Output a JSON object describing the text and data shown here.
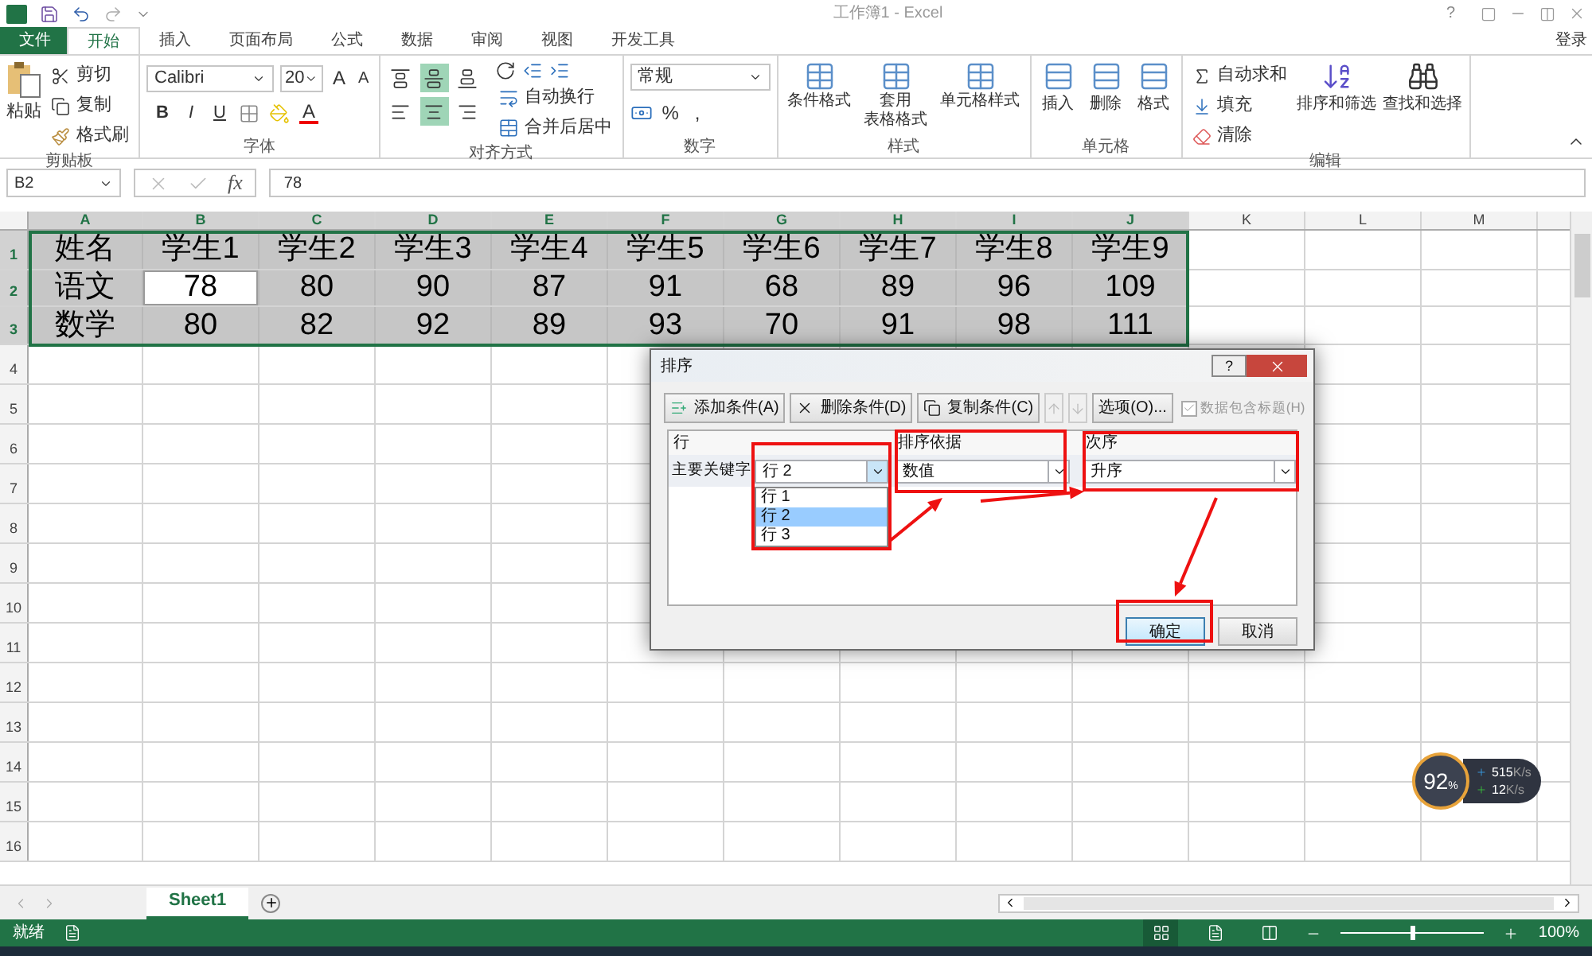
{
  "window": {
    "title": "工作簿1 - Excel",
    "help": "?",
    "account": "登录"
  },
  "tabs": [
    {
      "label": "文件",
      "kind": "file",
      "selected": false
    },
    {
      "label": "开始",
      "kind": "tab",
      "selected": true
    },
    {
      "label": "插入",
      "kind": "tab",
      "selected": false
    },
    {
      "label": "页面布局",
      "kind": "tab",
      "selected": false
    },
    {
      "label": "公式",
      "kind": "tab",
      "selected": false
    },
    {
      "label": "数据",
      "kind": "tab",
      "selected": false
    },
    {
      "label": "审阅",
      "kind": "tab",
      "selected": false
    },
    {
      "label": "视图",
      "kind": "tab",
      "selected": false
    },
    {
      "label": "开发工具",
      "kind": "tab",
      "selected": false
    }
  ],
  "ribbon": {
    "clipboard": {
      "label": "剪贴板",
      "paste": "粘贴",
      "cut": "剪切",
      "copy": "复制",
      "format_painter": "格式刷"
    },
    "font": {
      "label": "字体",
      "font_name": "Calibri",
      "font_size": "20",
      "style_buttons": [
        "B",
        "I",
        "U"
      ],
      "grow": "A",
      "shrink": "A",
      "font_color": "A"
    },
    "alignment": {
      "label": "对齐方式",
      "wrap": "自动换行",
      "merge": "合并后居中",
      "align_buttons": [
        {
          "kind": "top",
          "selected": false
        },
        {
          "kind": "middle",
          "selected": true
        },
        {
          "kind": "bottom",
          "selected": false
        },
        {
          "kind": "left",
          "selected": false
        },
        {
          "kind": "center",
          "selected": true
        },
        {
          "kind": "right",
          "selected": false
        }
      ]
    },
    "number": {
      "label": "数字",
      "format": "常规",
      "percent": "%",
      "comma": ","
    },
    "styles": {
      "label": "样式",
      "items": [
        {
          "lines": [
            "条件格式"
          ]
        },
        {
          "lines": [
            "套用",
            "表格格式"
          ]
        },
        {
          "lines": [
            "单元格样式"
          ]
        }
      ]
    },
    "cells": {
      "label": "单元格",
      "items": [
        "插入",
        "删除",
        "格式"
      ]
    },
    "editing": {
      "label": "编辑",
      "autosum": "自动求和",
      "fill": "填充",
      "clear": "清除",
      "sort_filter": "排序和筛选",
      "find_select": "查找和选择"
    }
  },
  "formula_bar": {
    "name_box": "B2",
    "fx": "fx",
    "value": "78"
  },
  "sheet": {
    "columns": [
      {
        "label": "A",
        "selected": true
      },
      {
        "label": "B",
        "selected": true
      },
      {
        "label": "C",
        "selected": true
      },
      {
        "label": "D",
        "selected": true
      },
      {
        "label": "E",
        "selected": true
      },
      {
        "label": "F",
        "selected": true
      },
      {
        "label": "G",
        "selected": true
      },
      {
        "label": "H",
        "selected": true
      },
      {
        "label": "I",
        "selected": true
      },
      {
        "label": "J",
        "selected": true
      },
      {
        "label": "K",
        "selected": false
      },
      {
        "label": "L",
        "selected": false
      },
      {
        "label": "M",
        "selected": false
      }
    ],
    "rows": [
      {
        "label": "1",
        "selected": true,
        "cells": [
          {
            "text": "姓名",
            "selected": false
          },
          {
            "text": "学生1",
            "selected": false
          },
          {
            "text": "学生2",
            "selected": false
          },
          {
            "text": "学生3",
            "selected": false
          },
          {
            "text": "学生4",
            "selected": false
          },
          {
            "text": "学生5",
            "selected": false
          },
          {
            "text": "学生6",
            "selected": false
          },
          {
            "text": "学生7",
            "selected": false
          },
          {
            "text": "学生8",
            "selected": false
          },
          {
            "text": "学生9",
            "selected": false
          }
        ]
      },
      {
        "label": "2",
        "selected": true,
        "cells": [
          {
            "text": "语文",
            "selected": false
          },
          {
            "text": "78",
            "selected": true
          },
          {
            "text": "80",
            "selected": false
          },
          {
            "text": "90",
            "selected": false
          },
          {
            "text": "87",
            "selected": false
          },
          {
            "text": "91",
            "selected": false
          },
          {
            "text": "68",
            "selected": false
          },
          {
            "text": "89",
            "selected": false
          },
          {
            "text": "96",
            "selected": false
          },
          {
            "text": "109",
            "selected": false
          }
        ]
      },
      {
        "label": "3",
        "selected": true,
        "cells": [
          {
            "text": "数学",
            "selected": false
          },
          {
            "text": "80",
            "selected": false
          },
          {
            "text": "82",
            "selected": false
          },
          {
            "text": "92",
            "selected": false
          },
          {
            "text": "89",
            "selected": false
          },
          {
            "text": "93",
            "selected": false
          },
          {
            "text": "70",
            "selected": false
          },
          {
            "text": "91",
            "selected": false
          },
          {
            "text": "98",
            "selected": false
          },
          {
            "text": "111",
            "selected": false
          }
        ]
      },
      {
        "label": "4",
        "selected": false
      },
      {
        "label": "5",
        "selected": false
      },
      {
        "label": "6",
        "selected": false
      },
      {
        "label": "7",
        "selected": false
      },
      {
        "label": "8",
        "selected": false
      },
      {
        "label": "9",
        "selected": false
      },
      {
        "label": "10",
        "selected": false
      },
      {
        "label": "11",
        "selected": false
      },
      {
        "label": "12",
        "selected": false
      },
      {
        "label": "13",
        "selected": false
      },
      {
        "label": "14",
        "selected": false
      },
      {
        "label": "15",
        "selected": false
      },
      {
        "label": "16",
        "selected": false
      }
    ]
  },
  "dialog": {
    "title": "排序",
    "help": "?",
    "toolbar": {
      "add": "添加条件(A)",
      "delete": "删除条件(D)",
      "copy": "复制条件(C)",
      "move_disabled": true,
      "options": "选项(O)...",
      "has_headers": {
        "label": "数据包含标题(H)",
        "checked": true,
        "disabled": true
      }
    },
    "headers": [
      "行",
      "排序依据",
      "次序"
    ],
    "key_label": "主要关键字",
    "key": "行 2",
    "key_options": [
      {
        "label": "行 1",
        "selected": false
      },
      {
        "label": "行 2",
        "selected": true
      },
      {
        "label": "行 3",
        "selected": false
      }
    ],
    "sort_on": "数值",
    "order": "升序",
    "ok": "确定",
    "cancel": "取消"
  },
  "sheet_tabs": [
    {
      "label": "Sheet1",
      "selected": true
    }
  ],
  "status_bar": {
    "status": "就绪",
    "zoom": "100%",
    "zoom_level": {
      "level": 0.5
    },
    "views": [
      {
        "kind": "normal",
        "selected": true
      },
      {
        "kind": "layout",
        "selected": false
      },
      {
        "kind": "break",
        "selected": false
      }
    ]
  },
  "speed_widget": {
    "percent": "92",
    "unit": "%",
    "up": "515",
    "up_unit": "K/s",
    "down": "12",
    "down_unit": "K/s"
  }
}
